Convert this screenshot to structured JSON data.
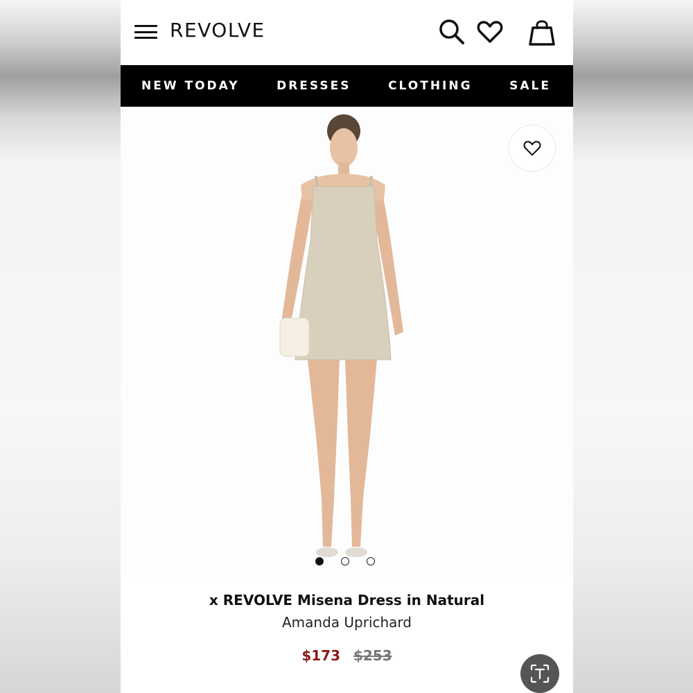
{
  "header": {
    "logo": "REVOLVE"
  },
  "nav": {
    "items": [
      {
        "label": "NEW TODAY"
      },
      {
        "label": "DRESSES"
      },
      {
        "label": "CLOTHING"
      },
      {
        "label": "SALE"
      }
    ]
  },
  "product": {
    "title": "x REVOLVE Misena Dress in Natural",
    "brand": "Amanda Uprichard",
    "price_sale": "$173",
    "price_original": "$253",
    "image_count": 3,
    "active_image": 1,
    "dress_color": "#d8cfbd"
  },
  "colors": {
    "sale_price": "#8b1a1a",
    "nav_bg": "#000000"
  },
  "icons": [
    "menu-icon",
    "search-icon",
    "heart-icon",
    "bag-icon",
    "text-scan-icon"
  ]
}
